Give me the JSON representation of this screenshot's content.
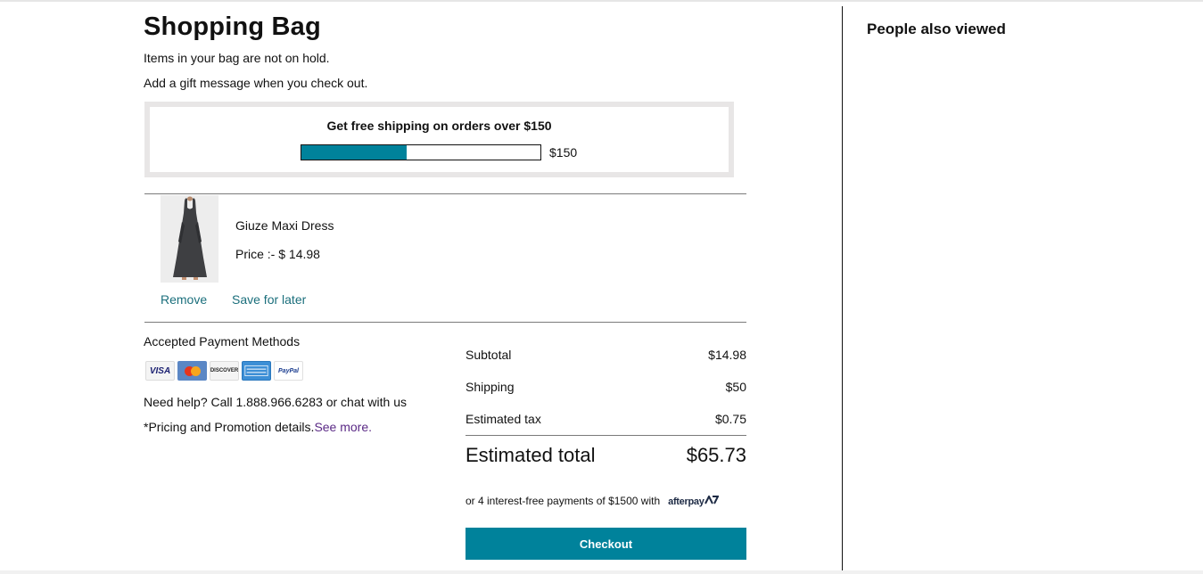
{
  "bag": {
    "title": "Shopping Bag",
    "notice_hold": "Items in your bag are not on hold.",
    "notice_gift": "Add a gift message when you check out."
  },
  "shipping_promo": {
    "headline": "Get free shipping on orders over $150",
    "threshold_label": "$150",
    "progress_fraction": 0.44,
    "accent": "#00829b"
  },
  "cart_items": [
    {
      "name": "Giuze Maxi Dress",
      "price_label": "Price :- $ 14.98",
      "remove_label": "Remove",
      "save_label": "Save for later"
    }
  ],
  "payment": {
    "title": "Accepted Payment Methods",
    "cards": [
      {
        "name": "visa-card-icon",
        "label": "VISA"
      },
      {
        "name": "mastercard-card-icon",
        "label": "MasterCard"
      },
      {
        "name": "discover-card-icon",
        "label": "DISCOVER"
      },
      {
        "name": "amex-card-icon",
        "label": "AMERICAN EXPRESS"
      },
      {
        "name": "paypal-card-icon",
        "label": "PayPal"
      }
    ]
  },
  "help": {
    "text": "Need help? Call 1.888.966.6283 or chat with us"
  },
  "promo": {
    "text": "*Pricing and Promotion details.",
    "link": "See more."
  },
  "summary": {
    "subtotal_label": "Subtotal",
    "subtotal_value": "$14.98",
    "shipping_label": "Shipping",
    "shipping_value": "$50",
    "tax_label": "Estimated tax",
    "tax_value": "$0.75",
    "total_label": "Estimated total",
    "total_value": "$65.73"
  },
  "afterpay": {
    "text": "or 4 interest-free payments of $1500 with",
    "logo": "afterpay"
  },
  "checkout": {
    "label": "Checkout"
  },
  "sidebar": {
    "title": "People also viewed"
  }
}
